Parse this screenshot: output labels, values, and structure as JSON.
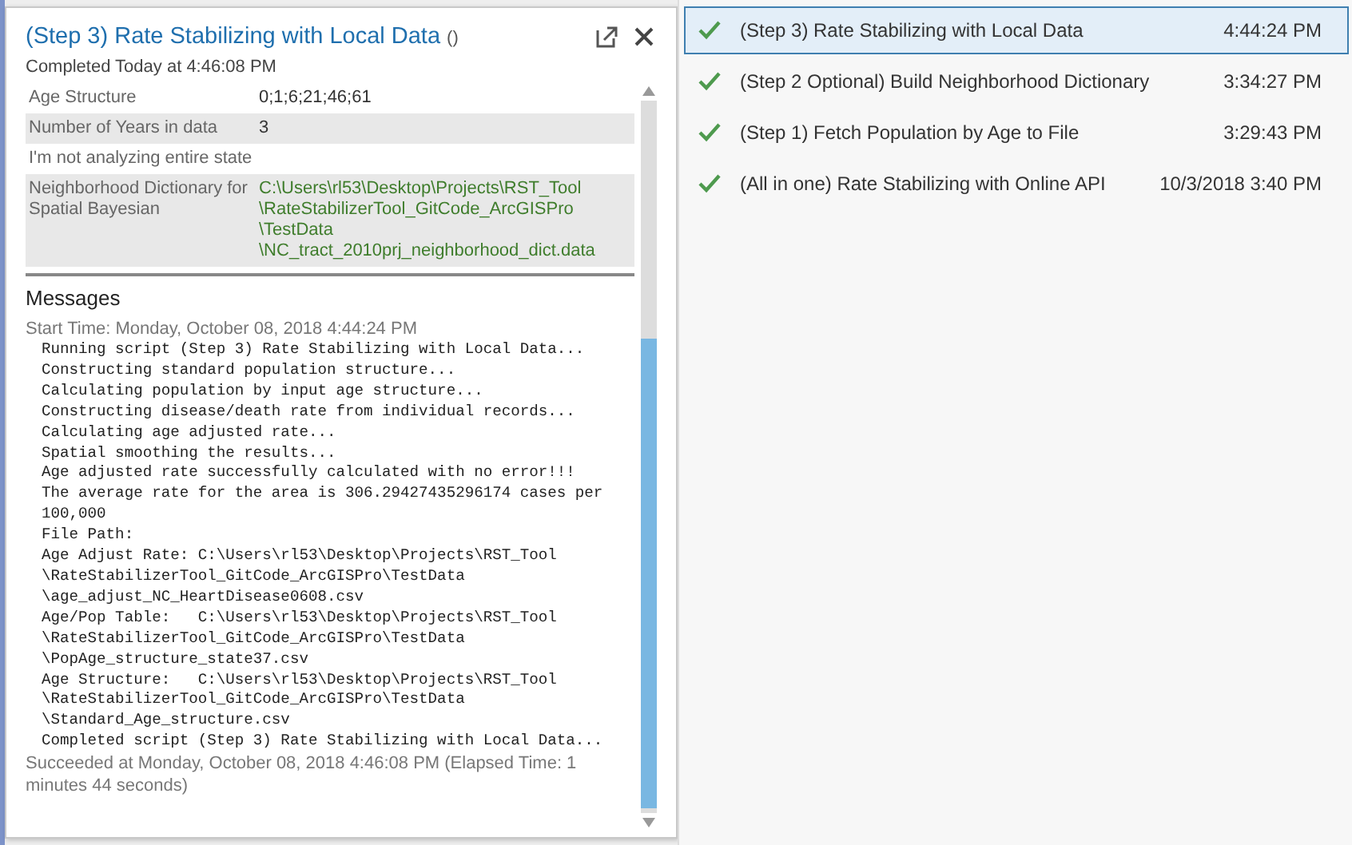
{
  "tool_result": {
    "title": "(Step 3) Rate Stabilizing with Local Data",
    "title_suffix": "()",
    "status": "Completed Today at 4:46:08 PM",
    "parameters": [
      {
        "label": "Age Structure",
        "value_lines": [
          "0;1;6;21;46;61"
        ],
        "kind": "text"
      },
      {
        "label": "Number of Years in data",
        "value_lines": [
          "3"
        ],
        "kind": "text"
      },
      {
        "label": "I'm not analyzing entire state",
        "kind": "text"
      },
      {
        "label": "Neighborhood Dictionary for Spatial Bayesian",
        "value_lines": [
          "C:\\Users\\rl53\\Desktop\\Projects\\RST_Tool",
          "\\RateStabilizerTool_GitCode_ArcGISPro",
          "\\TestData",
          "\\NC_tract_2010prj_neighborhood_dict.data"
        ],
        "kind": "path"
      }
    ],
    "messages_heading": "Messages",
    "start_time": "Start Time: Monday, October 08, 2018 4:44:24 PM",
    "messages": [
      "Running script (Step 3) Rate Stabilizing with Local Data...",
      "Constructing standard population structure...",
      "Calculating population by input age structure...",
      "Constructing disease/death rate from individual records...",
      "Calculating age adjusted rate...",
      "Spatial smoothing the results...",
      "Age adjusted rate successfully calculated with no error!!!",
      "The average rate for the area is 306.29427435296174 cases per",
      "100,000",
      "File Path:",
      "Age Adjust Rate: C:\\Users\\rl53\\Desktop\\Projects\\RST_Tool",
      "\\RateStabilizerTool_GitCode_ArcGISPro\\TestData",
      "\\age_adjust_NC_HeartDisease0608.csv",
      "Age/Pop Table:   C:\\Users\\rl53\\Desktop\\Projects\\RST_Tool",
      "\\RateStabilizerTool_GitCode_ArcGISPro\\TestData",
      "\\PopAge_structure_state37.csv",
      "Age Structure:   C:\\Users\\rl53\\Desktop\\Projects\\RST_Tool",
      "\\RateStabilizerTool_GitCode_ArcGISPro\\TestData",
      "\\Standard_Age_structure.csv",
      "Completed script (Step 3) Rate Stabilizing with Local Data..."
    ],
    "finish": "Succeeded at Monday, October 08, 2018 4:46:08 PM (Elapsed Time: 1 minutes 44 seconds)"
  },
  "history": [
    {
      "name": "(Step 3) Rate Stabilizing with Local Data",
      "time": "4:44:24 PM",
      "selected": true
    },
    {
      "name": "(Step 2 Optional) Build Neighborhood Dictionary",
      "time": "3:34:27 PM",
      "selected": false
    },
    {
      "name": "(Step 1) Fetch Population by Age to File",
      "time": "3:29:43 PM",
      "selected": false
    },
    {
      "name": "(All in one) Rate Stabilizing with Online API",
      "time": "10/3/2018 3:40 PM",
      "selected": false
    }
  ]
}
